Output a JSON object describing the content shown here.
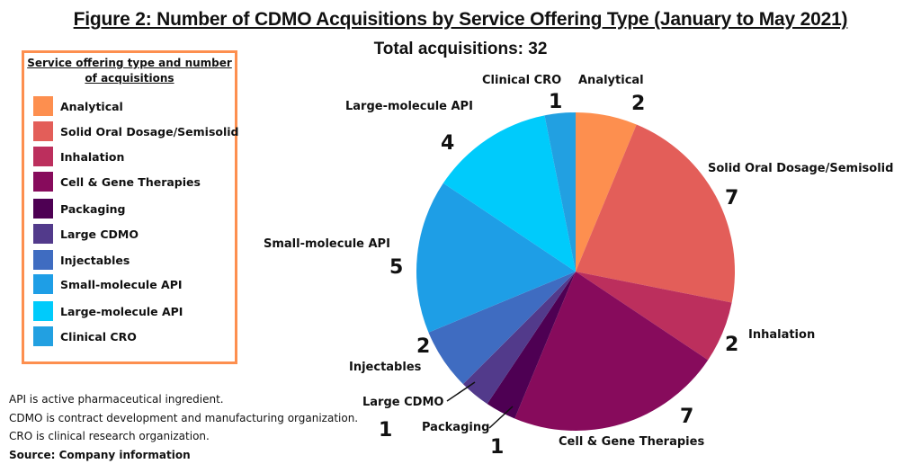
{
  "chart_data": {
    "type": "pie",
    "title": "Figure 2: Number of CDMO Acquisitions by Service Offering Type (January to May 2021)",
    "subtitle": "Total acquisitions: 32",
    "total": 32,
    "legend_title": "Service offering type and number of acquisitions",
    "legend_position": "left",
    "slices": [
      {
        "label": "Analytical",
        "value": 2,
        "color": "#fd8f4f"
      },
      {
        "label": "Solid Oral Dosage/Semisolid",
        "value": 7,
        "color": "#e35e59"
      },
      {
        "label": "Inhalation",
        "value": 2,
        "color": "#bc2f5d"
      },
      {
        "label": "Cell & Gene Therapies",
        "value": 7,
        "color": "#870b5c"
      },
      {
        "label": "Packaging",
        "value": 1,
        "color": "#4e0053"
      },
      {
        "label": "Large CDMO",
        "value": 1,
        "color": "#523a8b"
      },
      {
        "label": "Injectables",
        "value": 2,
        "color": "#3f6cc1"
      },
      {
        "label": "Small-molecule API",
        "value": 5,
        "color": "#1e9ee6"
      },
      {
        "label": "Large-molecule API",
        "value": 4,
        "color": "#00cbfb"
      },
      {
        "label": "Clinical CRO",
        "value": 1,
        "color": "#22a0e1"
      }
    ]
  },
  "notes": [
    "API is active pharmaceutical ingredient.",
    "CDMO is contract development and manufacturing organization.",
    "CRO is clinical research organization."
  ],
  "source": "Source: Company information"
}
